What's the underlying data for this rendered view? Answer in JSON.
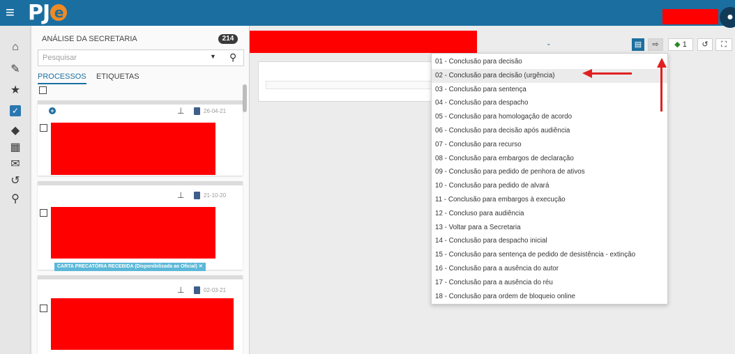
{
  "app": {
    "logo_main": "PJ",
    "logo_accent": "e"
  },
  "sidebar": {
    "title": "ANÁLISE DA SECRETARIA",
    "count": "214",
    "search_placeholder": "Pesquisar",
    "tabs": [
      "PROCESSOS",
      "ETIQUETAS"
    ],
    "cards": [
      {
        "date": "26-04-21",
        "tag": ""
      },
      {
        "date": "21-10-20",
        "tag": "CARTA PRECATÓRIA RECEBIDA (Disponibilizada ao Oficial) ✕"
      },
      {
        "date": "02-03-21",
        "tag": ""
      }
    ]
  },
  "toolbar": {
    "tag_count": "1"
  },
  "dropdown": {
    "highlighted_index": 1,
    "items": [
      "01 - Conclusão para decisão",
      "02 - Conclusão para decisão (urgência)",
      "03 - Conclusão para sentença",
      "04 - Conclusão para despacho",
      "05 - Conclusão para homologação de acordo",
      "06 - Conclusão para decisão após audiência",
      "07 - Conclusão para recurso",
      "08 - Conclusão para embargos de declaração",
      "09 - Conclusão para pedido de penhora de ativos",
      "10 - Conclusão para pedido de alvará",
      "11 - Conclusão para embargos à execução",
      "12 - Concluso para audiência",
      "13 - Voltar para a Secretaria",
      "14 - Conclusão para despacho inicial",
      "15 - Conclusão para sentença de pedido de desistência - extinção",
      "16 - Conclusão para a ausência do autor",
      "17 - Conclusão para a ausência do réu",
      "18 - Conclusão para ordem de bloqueio online"
    ]
  },
  "colors": {
    "brand": "#1b6fa0",
    "accent": "#f08a24",
    "annotation": "#e02020",
    "redaction": "#ff0000"
  }
}
